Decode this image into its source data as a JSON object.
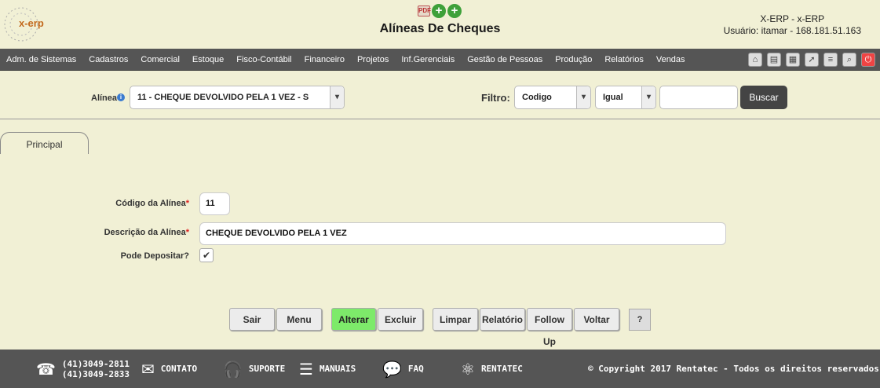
{
  "header": {
    "logo_text": "x-erp",
    "title": "Alíneas De Cheques",
    "user_line1": "X-ERP - x-ERP",
    "user_line2": "Usuário: itamar - 168.181.51.163",
    "icons": [
      "pdf-icon",
      "add-icon",
      "add-icon"
    ]
  },
  "menu": {
    "items": [
      "Adm. de Sistemas",
      "Cadastros",
      "Comercial",
      "Estoque",
      "Fisco-Contábil",
      "Financeiro",
      "Projetos",
      "Inf.Gerenciais",
      "Gestão de Pessoas",
      "Produção",
      "Relatórios",
      "Vendas"
    ],
    "tools": [
      "home-icon",
      "save-icon",
      "print-icon",
      "export-icon",
      "document-icon",
      "search-icon",
      "power-icon"
    ]
  },
  "filter": {
    "alinea_label": "Alínea",
    "alinea_value": "11 - CHEQUE DEVOLVIDO PELA 1 VEZ - S",
    "filtro_label": "Filtro:",
    "field_value": "Codigo",
    "op_value": "Igual",
    "search_value": "",
    "buscar_label": "Buscar"
  },
  "tabs": {
    "principal": "Principal"
  },
  "form": {
    "codigo_label": "Código da Alínea",
    "codigo_value": "11",
    "descricao_label": "Descrição da Alínea",
    "descricao_value": "CHEQUE DEVOLVIDO PELA 1 VEZ",
    "pode_label": "Pode Depositar?",
    "pode_checked": true,
    "required_mark": "*"
  },
  "buttons": {
    "sair": "Sair",
    "menu": "Menu",
    "alterar": "Alterar",
    "excluir": "Excluir",
    "limpar": "Limpar",
    "relatorio": "Relatório",
    "follow_up": "Follow Up",
    "voltar": "Voltar",
    "help": "?"
  },
  "footer": {
    "phone1": "(41)3049-2811",
    "phone2": "(41)3049-2833",
    "contato": "CONTATO",
    "suporte": "SUPORTE",
    "manuais": "MANUAIS",
    "faq": "FAQ",
    "rentatec": "RENTATEC",
    "copyright": "© Copyright 2017 Rentatec - Todos os direitos reservados"
  },
  "colors": {
    "background": "#f1f0d5",
    "menubar": "#555555",
    "accent_green": "#7dea6a",
    "footer": "#555555"
  }
}
